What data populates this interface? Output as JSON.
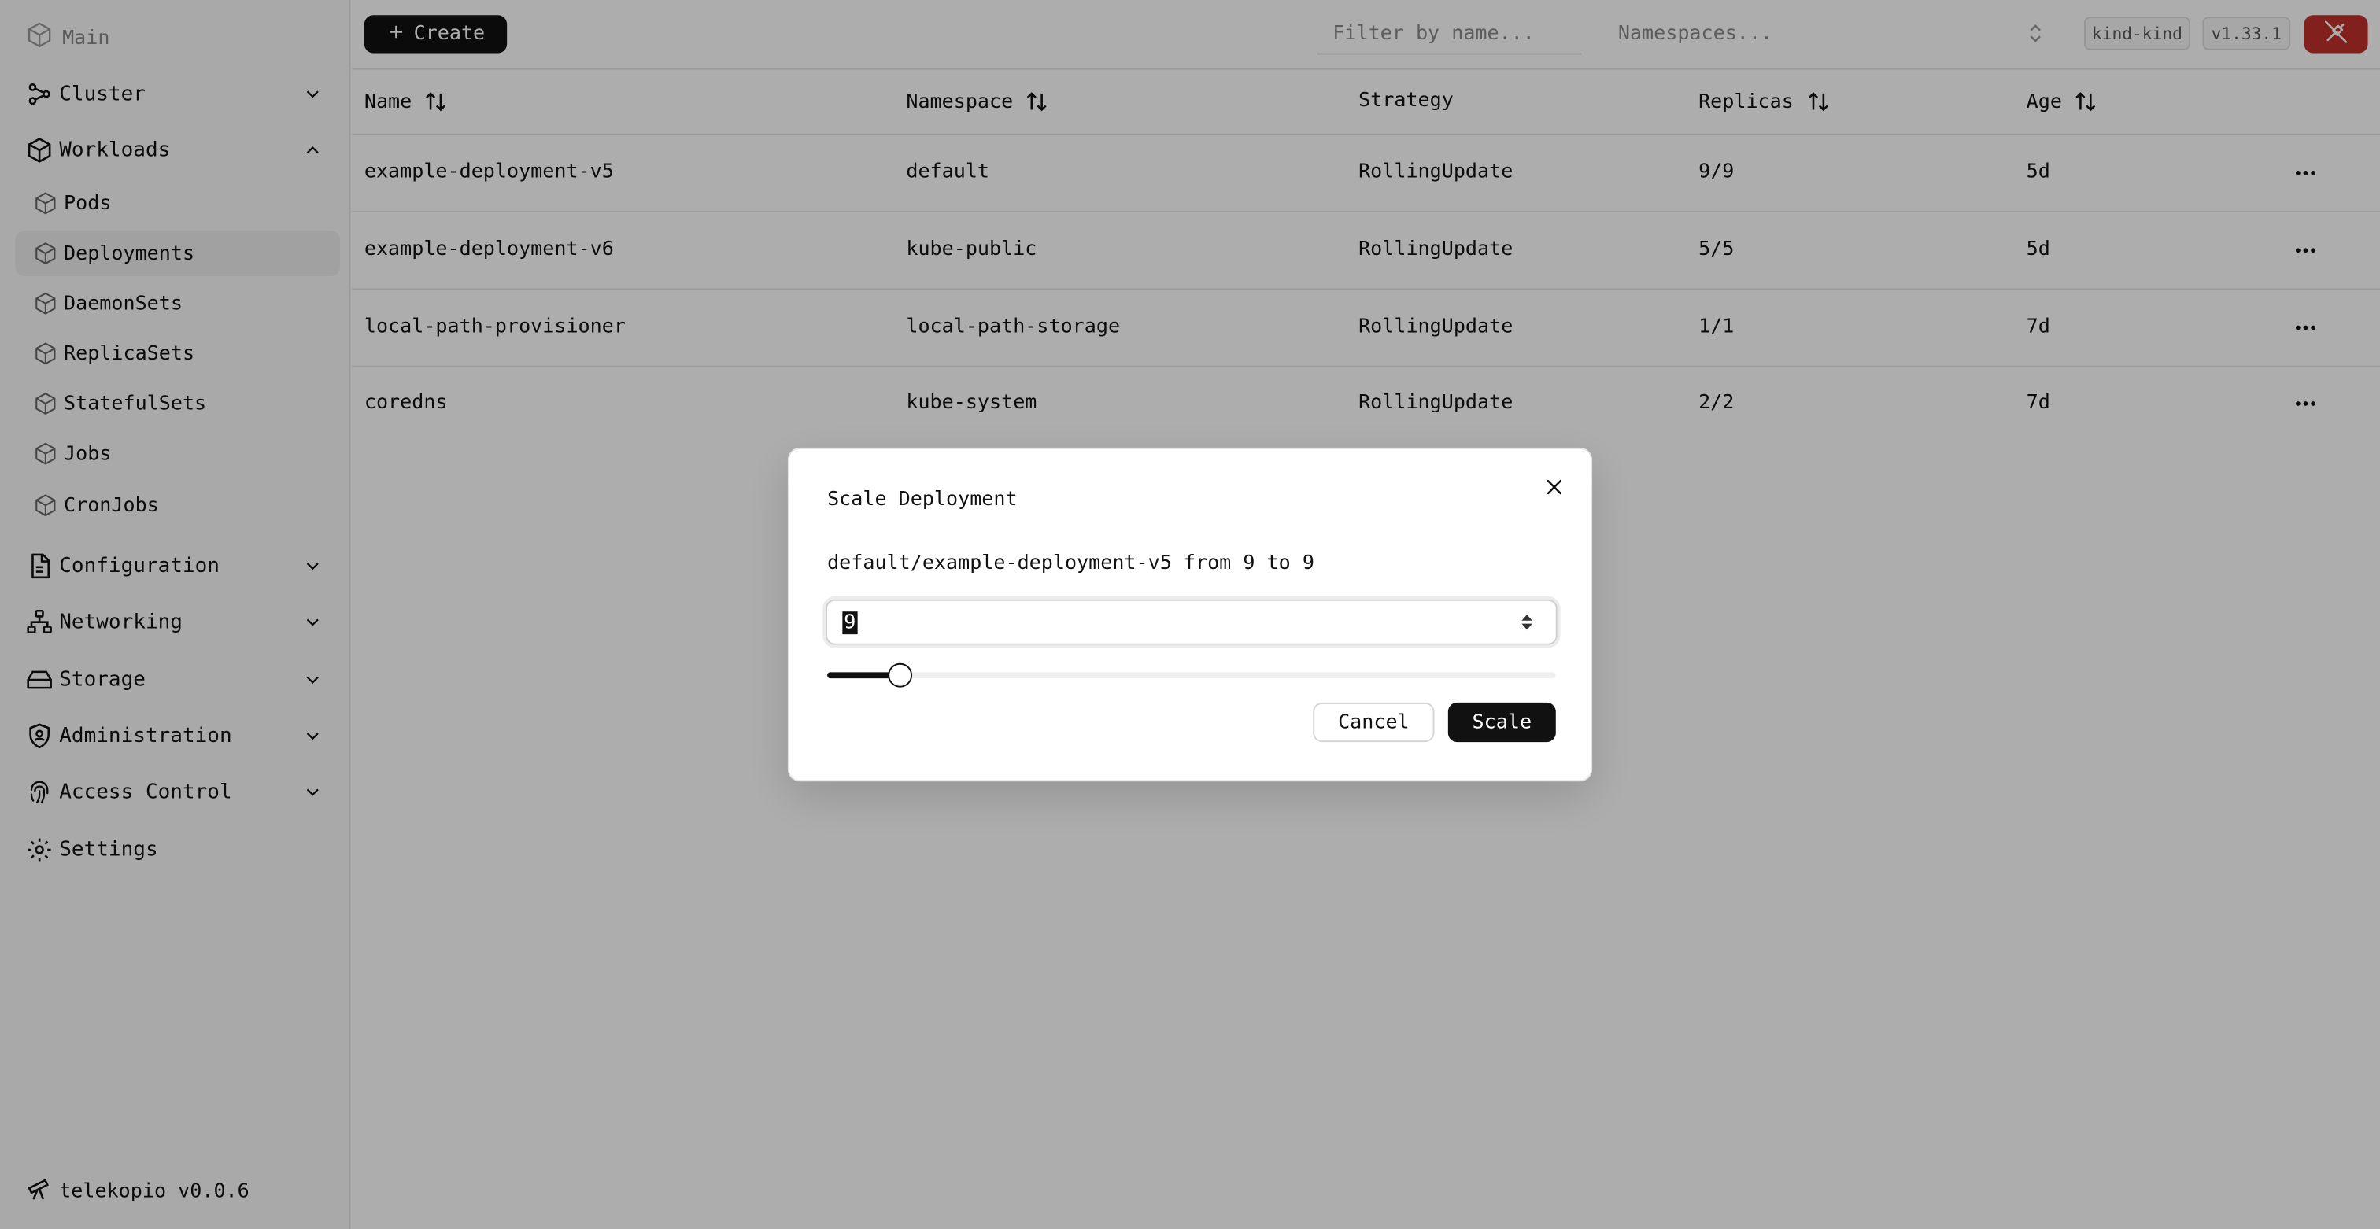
{
  "sidebar": {
    "main_label": "Main",
    "groups": {
      "cluster": "Cluster",
      "workloads": "Workloads",
      "configuration": "Configuration",
      "networking": "Networking",
      "storage": "Storage",
      "administration": "Administration",
      "access_control": "Access Control",
      "settings": "Settings"
    },
    "workload_items": [
      "Pods",
      "Deployments",
      "DaemonSets",
      "ReplicaSets",
      "StatefulSets",
      "Jobs",
      "CronJobs"
    ],
    "active_item": "Deployments",
    "footer": "telekopio v0.0.6"
  },
  "toolbar": {
    "create_label": "Create",
    "filter_placeholder": "Filter by name...",
    "namespace_placeholder": "Namespaces...",
    "cluster_badge": "kind-kind",
    "version_badge": "v1.33.1",
    "accent_color": "#c0302b"
  },
  "table": {
    "headers": {
      "name": "Name",
      "namespace": "Namespace",
      "strategy": "Strategy",
      "replicas": "Replicas",
      "age": "Age"
    },
    "rows": [
      {
        "name": "example-deployment-v5",
        "namespace": "default",
        "strategy": "RollingUpdate",
        "replicas": "9/9",
        "age": "5d"
      },
      {
        "name": "example-deployment-v6",
        "namespace": "kube-public",
        "strategy": "RollingUpdate",
        "replicas": "5/5",
        "age": "5d"
      },
      {
        "name": "local-path-provisioner",
        "namespace": "local-path-storage",
        "strategy": "RollingUpdate",
        "replicas": "1/1",
        "age": "7d"
      },
      {
        "name": "coredns",
        "namespace": "kube-system",
        "strategy": "RollingUpdate",
        "replicas": "2/2",
        "age": "7d"
      }
    ]
  },
  "modal": {
    "title": "Scale Deployment",
    "description": "default/example-deployment-v5 from 9 to 9",
    "input_value": "9",
    "slider_fraction": 0.1,
    "cancel_label": "Cancel",
    "scale_label": "Scale"
  }
}
